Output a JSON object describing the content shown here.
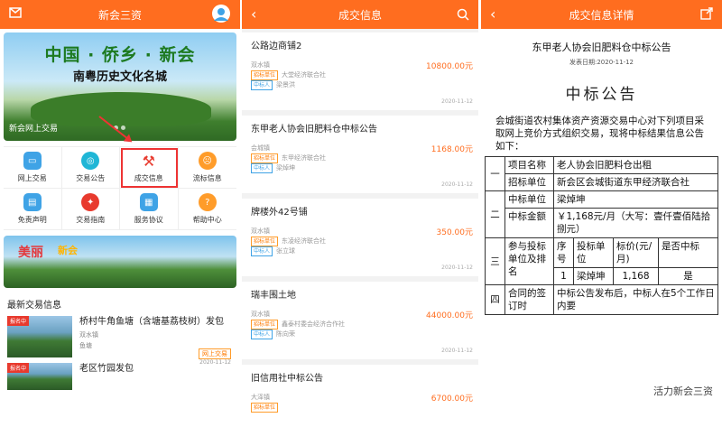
{
  "home": {
    "title": "新会三资",
    "banner_title": "中国 · 侨乡 · 新会",
    "banner_subtitle": "南粤历史文化名城",
    "banner_caption": "新会网上交易",
    "menu": [
      {
        "label": "网上交易",
        "color": "#3fa3e6"
      },
      {
        "label": "交易公告",
        "color": "#1fb6d6"
      },
      {
        "label": "成交信息",
        "color": "#e83a2e"
      },
      {
        "label": "流标信息",
        "color": "#ff9c2a"
      },
      {
        "label": "免责声明",
        "color": "#3fa3e6"
      },
      {
        "label": "交易指南",
        "color": "#e83a2e"
      },
      {
        "label": "服务协议",
        "color": "#3fa3e6"
      },
      {
        "label": "帮助中心",
        "color": "#ff9c2a"
      }
    ],
    "banner2_word1": "美丽",
    "banner2_word2": "新会",
    "section_title": "最新交易信息",
    "news": [
      {
        "tag": "报名中",
        "title": "桥村牛角鱼塘（含塘基荔枝树）发包",
        "type": "双水镇",
        "category": "鱼塘",
        "badge": "网上交易",
        "date": "2020-11-12"
      },
      {
        "tag": "报名中",
        "title": "老区竹园发包"
      }
    ]
  },
  "list": {
    "title": "成交信息",
    "items": [
      {
        "title": "公路边商铺2",
        "town": "双水镇",
        "org": "大堂经济联合社",
        "person": "梁景洪",
        "price": "10800.00元",
        "date": "2020-11-12"
      },
      {
        "title": "东甲老人协会旧肥料仓中标公告",
        "town": "会城镇",
        "org": "东甲经济联合社",
        "person": "梁焯坤",
        "price": "1168.00元",
        "date": "2020-11-12"
      },
      {
        "title": "牌楼外42号铺",
        "town": "双水镇",
        "org": "东凌经济联合社",
        "person": "张立球",
        "price": "350.00元",
        "date": "2020-11-12"
      },
      {
        "title": "瑞丰围土地",
        "town": "双水镇",
        "org": "鑫泰村委会经济合作社",
        "person": "陈向荣",
        "price": "44000.00元",
        "date": "2020-11-12"
      },
      {
        "title": "旧信用社中标公告",
        "town": "大泽镇",
        "org": "",
        "person": "",
        "price": "6700.00元",
        "date": ""
      }
    ],
    "tag_org": "招标单位",
    "tag_winner": "中标人"
  },
  "detail": {
    "title": "成交信息详情",
    "doc_title": "东甲老人协会旧肥料仓中标公告",
    "date": "发表日期:2020-11-12",
    "heading": "中标公告",
    "intro": "会城街道农村集体资产资源交易中心对下列项目采取网上竞价方式组织交易，现将中标结果信息公告如下：",
    "rows": [
      {
        "group": "一",
        "label": "项目名称",
        "value": "老人协会旧肥料仓出租"
      },
      {
        "label": "招标单位",
        "value": "新会区会城街道东甲经济联合社"
      },
      {
        "group": "二",
        "label": "中标单位",
        "value": "梁焯坤"
      },
      {
        "label": "中标金额",
        "value": "￥1,168元/月（大写：壹仟壹佰陆拾捌元）"
      }
    ],
    "rank_label": "参与投标单位及排名",
    "rank_group": "三",
    "rank_head": [
      "序号",
      "投标单位",
      "标价(元/月)",
      "是否中标"
    ],
    "rank_row": [
      "1",
      "梁焯坤",
      "1,168",
      "是"
    ],
    "last_group": "四",
    "last_label": "合同的签订时",
    "last_value": "中标公告发布后，中标人在5个工作日内要",
    "watermark": "活力新会三资"
  }
}
